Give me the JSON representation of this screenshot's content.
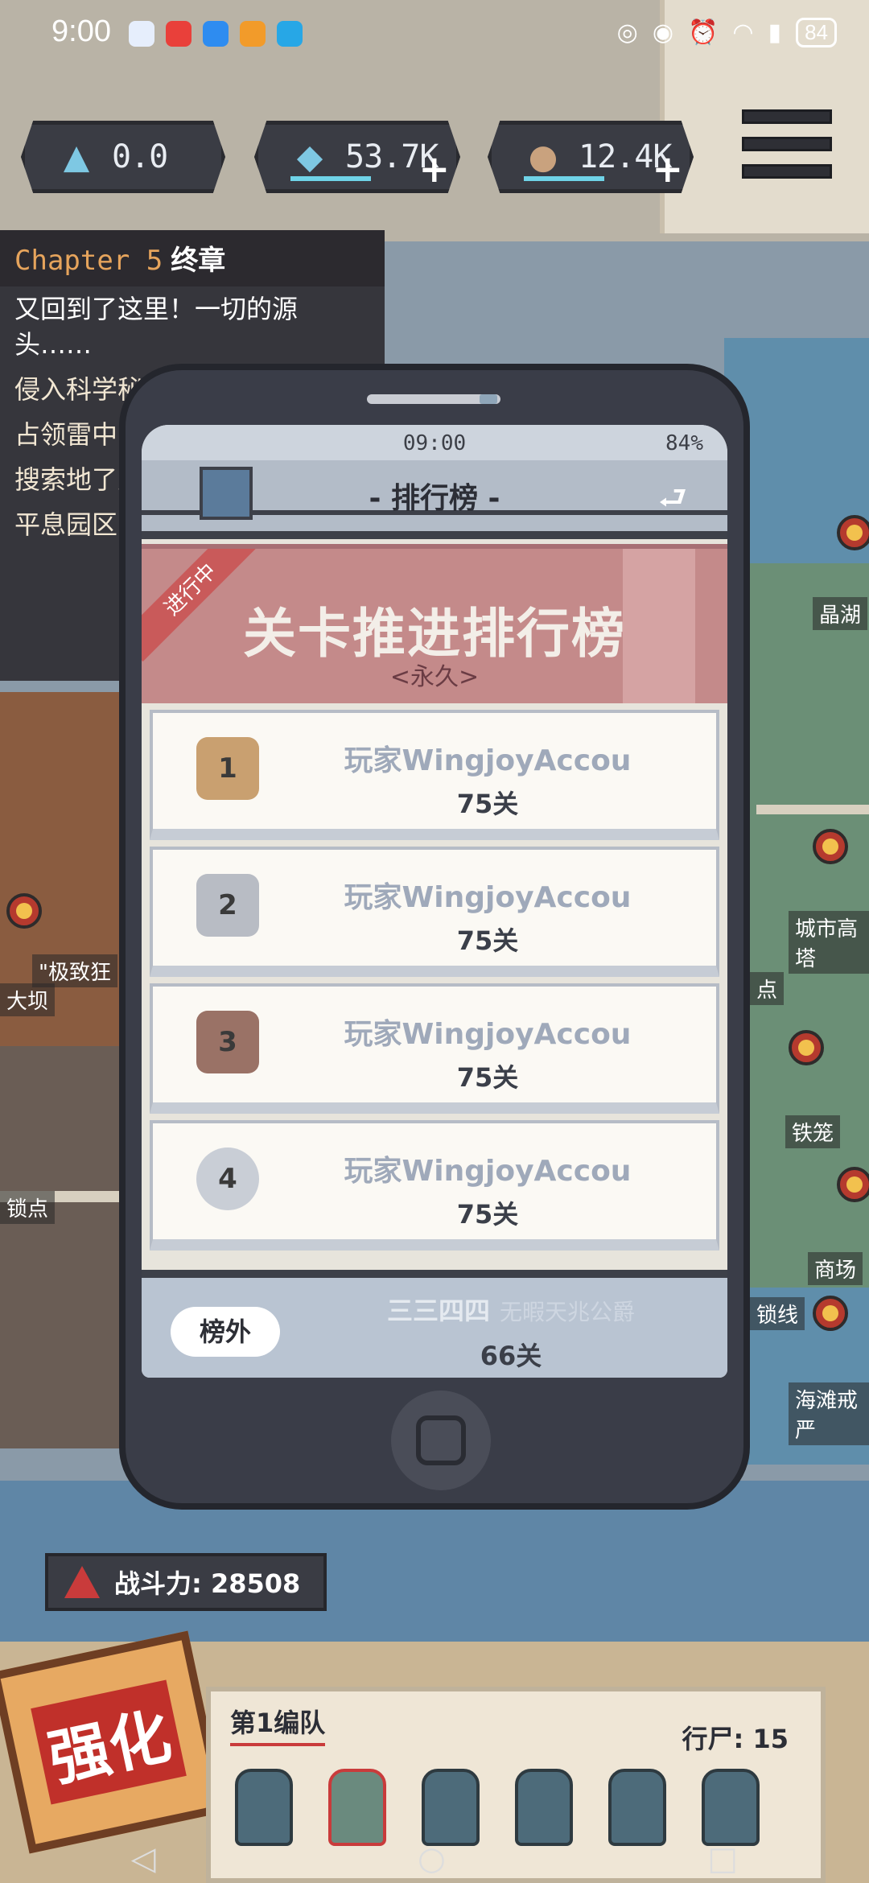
{
  "status_bar": {
    "time": "9:00",
    "battery": "84",
    "icons": [
      "calendar-icon",
      "huawei-icon",
      "message-icon",
      "app-icon",
      "browser-icon",
      "nfc-icon",
      "eye-icon",
      "alarm-icon",
      "wifi-icon",
      "signal-icon"
    ]
  },
  "resources": [
    {
      "icon": "triangle-icon",
      "value": "0.0",
      "color": "#7ec8e3"
    },
    {
      "icon": "gem-icon",
      "value": "53.7K",
      "color": "#7ec8e3"
    },
    {
      "icon": "coin-icon",
      "value": "12.4K",
      "color": "#c9a27e"
    }
  ],
  "quest": {
    "chapter": "Chapter 5",
    "chapter_title": "终章",
    "items": [
      "又回到了这里！一切的源头……",
      "侵入科学秘密",
      "占领雷中",
      "搜索地了克逃走！",
      "平息园区"
    ]
  },
  "map_labels": [
    "晶湖",
    "城市高塔",
    "铁笼",
    "商场",
    "海滩戒严",
    "\"极致狂",
    "大坝",
    "锁点",
    "点",
    "锁线"
  ],
  "phone": {
    "status_time": "09:00",
    "status_battery": "84%",
    "header_title": "- 排行榜 -",
    "back_icon": "back-arrow-icon",
    "banner_ribbon": "进行中",
    "banner_title": "关卡推进排行榜",
    "banner_sub": "<永久>",
    "rows": [
      {
        "rank": "1",
        "name": "玩家WingjoyAccou",
        "stage": "75关",
        "medal_color": "#c9a070"
      },
      {
        "rank": "2",
        "name": "玩家WingjoyAccou",
        "stage": "75关",
        "medal_color": "#b8bcc4"
      },
      {
        "rank": "3",
        "name": "玩家WingjoyAccou",
        "stage": "75关",
        "medal_color": "#9a7266"
      },
      {
        "rank": "4",
        "name": "玩家WingjoyAccou",
        "stage": "75关",
        "medal_color": "#c9ced6"
      }
    ],
    "self": {
      "label": "榜外",
      "name": "三三四四",
      "title": "无暇天兆公爵",
      "stage": "66关"
    }
  },
  "hud": {
    "power_label": "战斗力: 28508",
    "boost_label": "强化",
    "squad_label": "第1编队",
    "zombie_label": "行尸: 15"
  },
  "nav": {
    "back": "◁",
    "home": "○",
    "recents": "□"
  }
}
